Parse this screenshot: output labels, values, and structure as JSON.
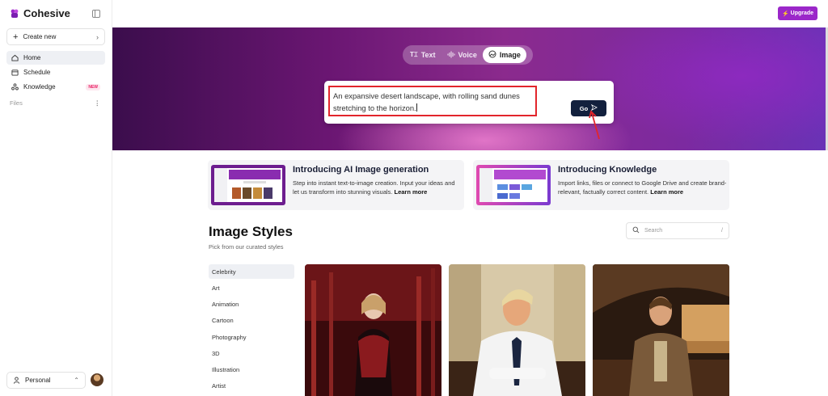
{
  "sidebar": {
    "brand": "Cohesive",
    "create_label": "Create new",
    "nav": [
      {
        "label": "Home",
        "icon": "home-icon"
      },
      {
        "label": "Schedule",
        "icon": "calendar-icon"
      },
      {
        "label": "Knowledge",
        "icon": "knowledge-icon",
        "badge": "NEW"
      }
    ],
    "files_label": "Files",
    "workspace_label": "Personal"
  },
  "header": {
    "upgrade_label": "Upgrade"
  },
  "hero": {
    "tabs": [
      {
        "label": "Text",
        "icon": "text-cursor-icon"
      },
      {
        "label": "Voice",
        "icon": "waveform-icon"
      },
      {
        "label": "Image",
        "icon": "image-icon",
        "active": true
      }
    ],
    "prompt_value": "An expansive desert landscape, with rolling sand dunes stretching to the horizon.",
    "go_label": "Go"
  },
  "cards": [
    {
      "title": "Introducing AI Image generation",
      "description": "Step into instant text-to-image creation. Input your ideas and let us transform into stunning visuals.",
      "link": "Learn more"
    },
    {
      "title": "Introducing Knowledge",
      "description": "Import links, files or connect to Google Drive and create brand-relevant, factually correct content.",
      "link": "Learn more"
    }
  ],
  "styles": {
    "title": "Image Styles",
    "subtitle": "Pick from our curated styles",
    "search_placeholder": "Search",
    "search_shortcut": "/",
    "categories": [
      "Celebrity",
      "Art",
      "Animation",
      "Cartoon",
      "Photography",
      "3D",
      "Illustration",
      "Artist"
    ],
    "active_category": "Celebrity"
  },
  "colors": {
    "accent": "#9b27c9",
    "go_button": "#12203d",
    "highlight": "#e2252b"
  }
}
